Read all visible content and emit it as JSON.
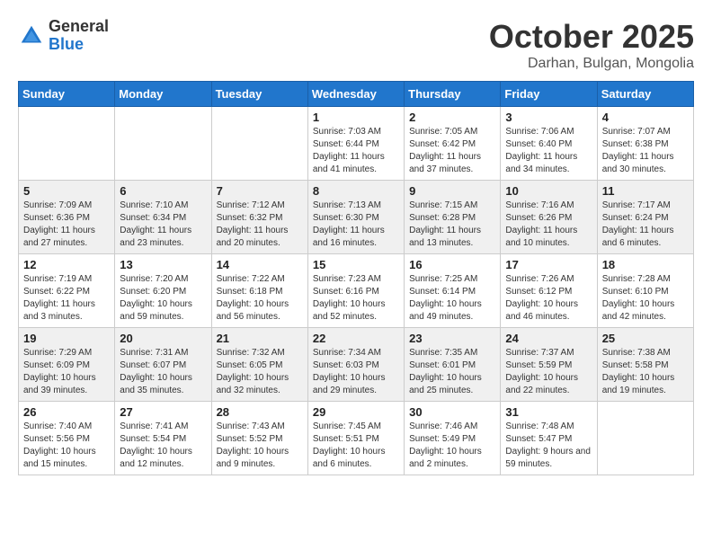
{
  "logo": {
    "general": "General",
    "blue": "Blue"
  },
  "header": {
    "month": "October 2025",
    "location": "Darhan, Bulgan, Mongolia"
  },
  "weekdays": [
    "Sunday",
    "Monday",
    "Tuesday",
    "Wednesday",
    "Thursday",
    "Friday",
    "Saturday"
  ],
  "weeks": [
    [
      {
        "day": "",
        "info": ""
      },
      {
        "day": "",
        "info": ""
      },
      {
        "day": "",
        "info": ""
      },
      {
        "day": "1",
        "info": "Sunrise: 7:03 AM\nSunset: 6:44 PM\nDaylight: 11 hours and 41 minutes."
      },
      {
        "day": "2",
        "info": "Sunrise: 7:05 AM\nSunset: 6:42 PM\nDaylight: 11 hours and 37 minutes."
      },
      {
        "day": "3",
        "info": "Sunrise: 7:06 AM\nSunset: 6:40 PM\nDaylight: 11 hours and 34 minutes."
      },
      {
        "day": "4",
        "info": "Sunrise: 7:07 AM\nSunset: 6:38 PM\nDaylight: 11 hours and 30 minutes."
      }
    ],
    [
      {
        "day": "5",
        "info": "Sunrise: 7:09 AM\nSunset: 6:36 PM\nDaylight: 11 hours and 27 minutes."
      },
      {
        "day": "6",
        "info": "Sunrise: 7:10 AM\nSunset: 6:34 PM\nDaylight: 11 hours and 23 minutes."
      },
      {
        "day": "7",
        "info": "Sunrise: 7:12 AM\nSunset: 6:32 PM\nDaylight: 11 hours and 20 minutes."
      },
      {
        "day": "8",
        "info": "Sunrise: 7:13 AM\nSunset: 6:30 PM\nDaylight: 11 hours and 16 minutes."
      },
      {
        "day": "9",
        "info": "Sunrise: 7:15 AM\nSunset: 6:28 PM\nDaylight: 11 hours and 13 minutes."
      },
      {
        "day": "10",
        "info": "Sunrise: 7:16 AM\nSunset: 6:26 PM\nDaylight: 11 hours and 10 minutes."
      },
      {
        "day": "11",
        "info": "Sunrise: 7:17 AM\nSunset: 6:24 PM\nDaylight: 11 hours and 6 minutes."
      }
    ],
    [
      {
        "day": "12",
        "info": "Sunrise: 7:19 AM\nSunset: 6:22 PM\nDaylight: 11 hours and 3 minutes."
      },
      {
        "day": "13",
        "info": "Sunrise: 7:20 AM\nSunset: 6:20 PM\nDaylight: 10 hours and 59 minutes."
      },
      {
        "day": "14",
        "info": "Sunrise: 7:22 AM\nSunset: 6:18 PM\nDaylight: 10 hours and 56 minutes."
      },
      {
        "day": "15",
        "info": "Sunrise: 7:23 AM\nSunset: 6:16 PM\nDaylight: 10 hours and 52 minutes."
      },
      {
        "day": "16",
        "info": "Sunrise: 7:25 AM\nSunset: 6:14 PM\nDaylight: 10 hours and 49 minutes."
      },
      {
        "day": "17",
        "info": "Sunrise: 7:26 AM\nSunset: 6:12 PM\nDaylight: 10 hours and 46 minutes."
      },
      {
        "day": "18",
        "info": "Sunrise: 7:28 AM\nSunset: 6:10 PM\nDaylight: 10 hours and 42 minutes."
      }
    ],
    [
      {
        "day": "19",
        "info": "Sunrise: 7:29 AM\nSunset: 6:09 PM\nDaylight: 10 hours and 39 minutes."
      },
      {
        "day": "20",
        "info": "Sunrise: 7:31 AM\nSunset: 6:07 PM\nDaylight: 10 hours and 35 minutes."
      },
      {
        "day": "21",
        "info": "Sunrise: 7:32 AM\nSunset: 6:05 PM\nDaylight: 10 hours and 32 minutes."
      },
      {
        "day": "22",
        "info": "Sunrise: 7:34 AM\nSunset: 6:03 PM\nDaylight: 10 hours and 29 minutes."
      },
      {
        "day": "23",
        "info": "Sunrise: 7:35 AM\nSunset: 6:01 PM\nDaylight: 10 hours and 25 minutes."
      },
      {
        "day": "24",
        "info": "Sunrise: 7:37 AM\nSunset: 5:59 PM\nDaylight: 10 hours and 22 minutes."
      },
      {
        "day": "25",
        "info": "Sunrise: 7:38 AM\nSunset: 5:58 PM\nDaylight: 10 hours and 19 minutes."
      }
    ],
    [
      {
        "day": "26",
        "info": "Sunrise: 7:40 AM\nSunset: 5:56 PM\nDaylight: 10 hours and 15 minutes."
      },
      {
        "day": "27",
        "info": "Sunrise: 7:41 AM\nSunset: 5:54 PM\nDaylight: 10 hours and 12 minutes."
      },
      {
        "day": "28",
        "info": "Sunrise: 7:43 AM\nSunset: 5:52 PM\nDaylight: 10 hours and 9 minutes."
      },
      {
        "day": "29",
        "info": "Sunrise: 7:45 AM\nSunset: 5:51 PM\nDaylight: 10 hours and 6 minutes."
      },
      {
        "day": "30",
        "info": "Sunrise: 7:46 AM\nSunset: 5:49 PM\nDaylight: 10 hours and 2 minutes."
      },
      {
        "day": "31",
        "info": "Sunrise: 7:48 AM\nSunset: 5:47 PM\nDaylight: 9 hours and 59 minutes."
      },
      {
        "day": "",
        "info": ""
      }
    ]
  ]
}
